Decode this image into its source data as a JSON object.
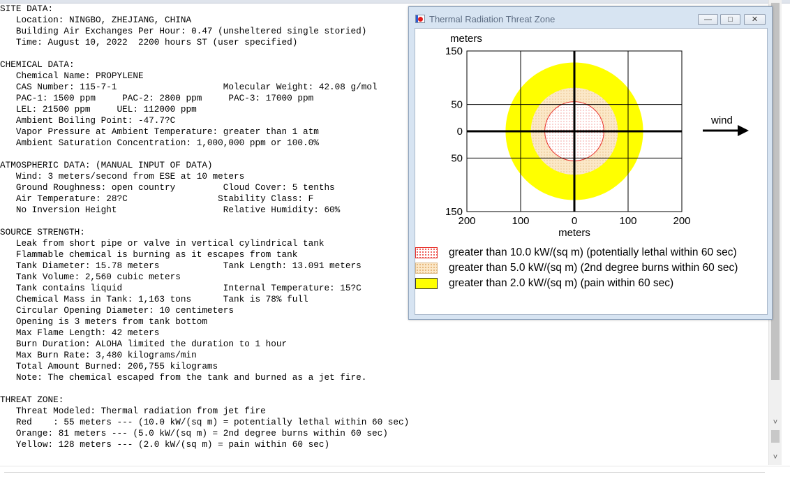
{
  "report": {
    "lines": [
      "SITE DATA:",
      "   Location: NINGBO, ZHEJIANG, CHINA",
      "   Building Air Exchanges Per Hour: 0.47 (unsheltered single storied)",
      "   Time: August 10, 2022  2200 hours ST (user specified)",
      "",
      "CHEMICAL DATA:",
      "   Chemical Name: PROPYLENE",
      "   CAS Number: 115-7-1                    Molecular Weight: 42.08 g/mol",
      "   PAC-1: 1500 ppm     PAC-2: 2800 ppm     PAC-3: 17000 ppm",
      "   LEL: 21500 ppm     UEL: 112000 ppm",
      "   Ambient Boiling Point: -47.7?C",
      "   Vapor Pressure at Ambient Temperature: greater than 1 atm",
      "   Ambient Saturation Concentration: 1,000,000 ppm or 100.0%",
      "",
      "ATMOSPHERIC DATA: (MANUAL INPUT OF DATA)",
      "   Wind: 3 meters/second from ESE at 10 meters",
      "   Ground Roughness: open country         Cloud Cover: 5 tenths",
      "   Air Temperature: 28?C                 Stability Class: F",
      "   No Inversion Height                    Relative Humidity: 60%",
      "",
      "SOURCE STRENGTH:",
      "   Leak from short pipe or valve in vertical cylindrical tank",
      "   Flammable chemical is burning as it escapes from tank",
      "   Tank Diameter: 15.78 meters            Tank Length: 13.091 meters",
      "   Tank Volume: 2,560 cubic meters",
      "   Tank contains liquid                   Internal Temperature: 15?C",
      "   Chemical Mass in Tank: 1,163 tons      Tank is 78% full",
      "   Circular Opening Diameter: 10 centimeters",
      "   Opening is 3 meters from tank bottom",
      "   Max Flame Length: 42 meters",
      "   Burn Duration: ALOHA limited the duration to 1 hour",
      "   Max Burn Rate: 3,480 kilograms/min",
      "   Total Amount Burned: 206,755 kilograms",
      "   Note: The chemical escaped from the tank and burned as a jet fire.",
      "",
      "THREAT ZONE:",
      "   Threat Modeled: Thermal radiation from jet fire",
      "   Red    : 55 meters --- (10.0 kW/(sq m) = potentially lethal within 60 sec)",
      "   Orange: 81 meters --- (5.0 kW/(sq m) = 2nd degree burns within 60 sec)",
      "   Yellow: 128 meters --- (2.0 kW/(sq m) = pain within 60 sec)"
    ]
  },
  "window": {
    "title": "Thermal Radiation Threat Zone",
    "minimize_glyph": "—",
    "maximize_glyph": "□",
    "close_glyph": "✕"
  },
  "scrollbar": {
    "up_glyph": "˄",
    "down_glyph": "˅"
  },
  "chart_data": {
    "type": "area",
    "ylabel": "meters",
    "xlabel": "meters",
    "xlim": [
      -200,
      200
    ],
    "ylim": [
      -150,
      150
    ],
    "xticks": [
      -200,
      -100,
      0,
      100,
      200
    ],
    "xtick_labels": [
      "200",
      "100",
      "0",
      "100",
      "200"
    ],
    "yticks": [
      150,
      50,
      0,
      -50,
      -150
    ],
    "ytick_labels": [
      "150",
      "50",
      "0",
      "50",
      "150"
    ],
    "grid": true,
    "wind_label": "wind",
    "wind_direction": "right",
    "zones": [
      {
        "name": "greater than 10.0 kW/(sq m) (potentially lethal within 60 sec)",
        "radius": 55,
        "color": "#e8302a",
        "fill": "#ffffff",
        "pattern": "red-dots"
      },
      {
        "name": "greater than 5.0 kW/(sq m) (2nd degree burns within 60 sec)",
        "radius": 81,
        "color": "#f7dcae",
        "fill": "#fbe8c8",
        "pattern": "orange-dots"
      },
      {
        "name": "greater than 2.0 kW/(sq m) (pain within 60 sec)",
        "radius": 128,
        "color": "#ffff00",
        "fill": "#ffff00",
        "pattern": "solid"
      }
    ],
    "legend": {
      "position": "bottom"
    }
  }
}
